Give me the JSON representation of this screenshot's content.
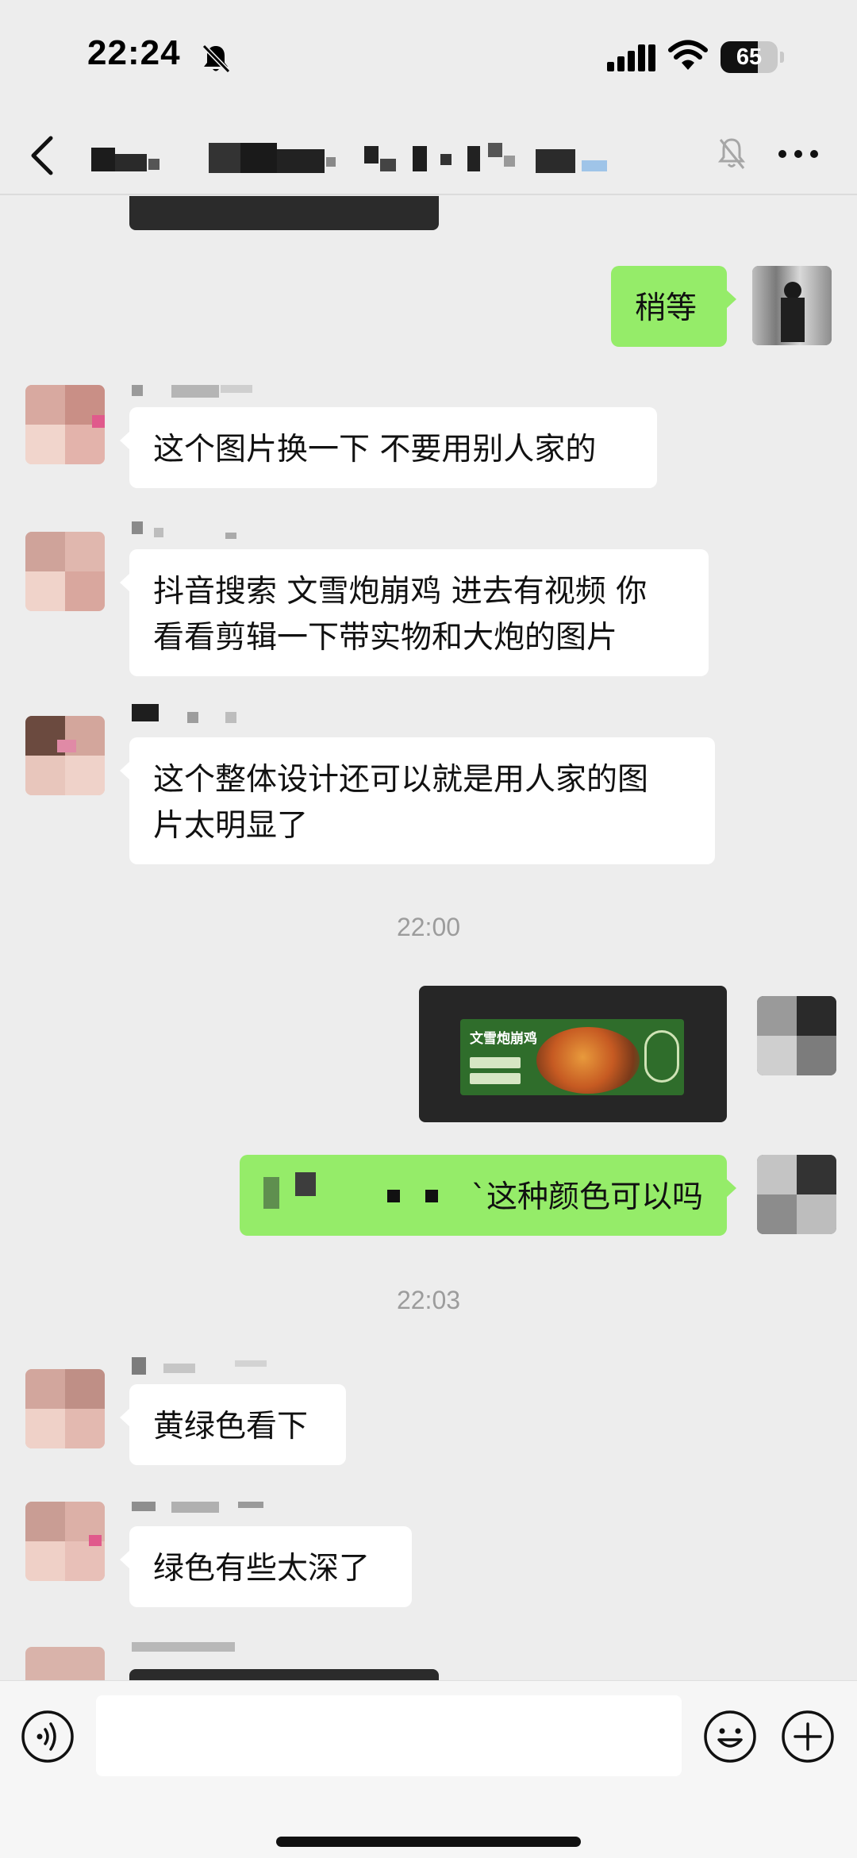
{
  "status_bar": {
    "time": "22:24",
    "battery_level": "65",
    "icons": [
      "bell-slash-icon",
      "cellular-signal-icon",
      "wifi-icon",
      "battery-icon"
    ]
  },
  "nav": {
    "icons": [
      "chevron-left-icon",
      "bell-slash-icon",
      "more-horizontal-icon"
    ]
  },
  "messages": [
    {
      "side": "right",
      "text": "稍等"
    },
    {
      "side": "left",
      "text": "这个图片换一下 不要用别人家的"
    },
    {
      "side": "left",
      "lines": [
        "抖音搜索 文雪炮崩鸡 进去有视频 你",
        "看看剪辑一下带实物和大炮的图片"
      ]
    },
    {
      "side": "left",
      "lines": [
        "这个整体设计还可以就是用人家的图",
        "片太明显了"
      ]
    },
    {
      "side": "right",
      "image": "banner",
      "banner_title": "文雪炮崩鸡"
    },
    {
      "side": "right",
      "text": "`这种颜色可以吗"
    },
    {
      "side": "left",
      "text": "黄绿色看下"
    },
    {
      "side": "left",
      "text": "绿色有些太深了"
    }
  ],
  "timestamps": [
    "22:00",
    "22:03"
  ],
  "input_bar": {
    "message_value": "",
    "icons": [
      "voice-icon",
      "emoji-icon",
      "plus-icon"
    ]
  },
  "colors": {
    "background": "#ededed",
    "outgoing_bubble": "#95ec69",
    "incoming_bubble": "#ffffff",
    "timestamp": "#9c9c9c"
  }
}
